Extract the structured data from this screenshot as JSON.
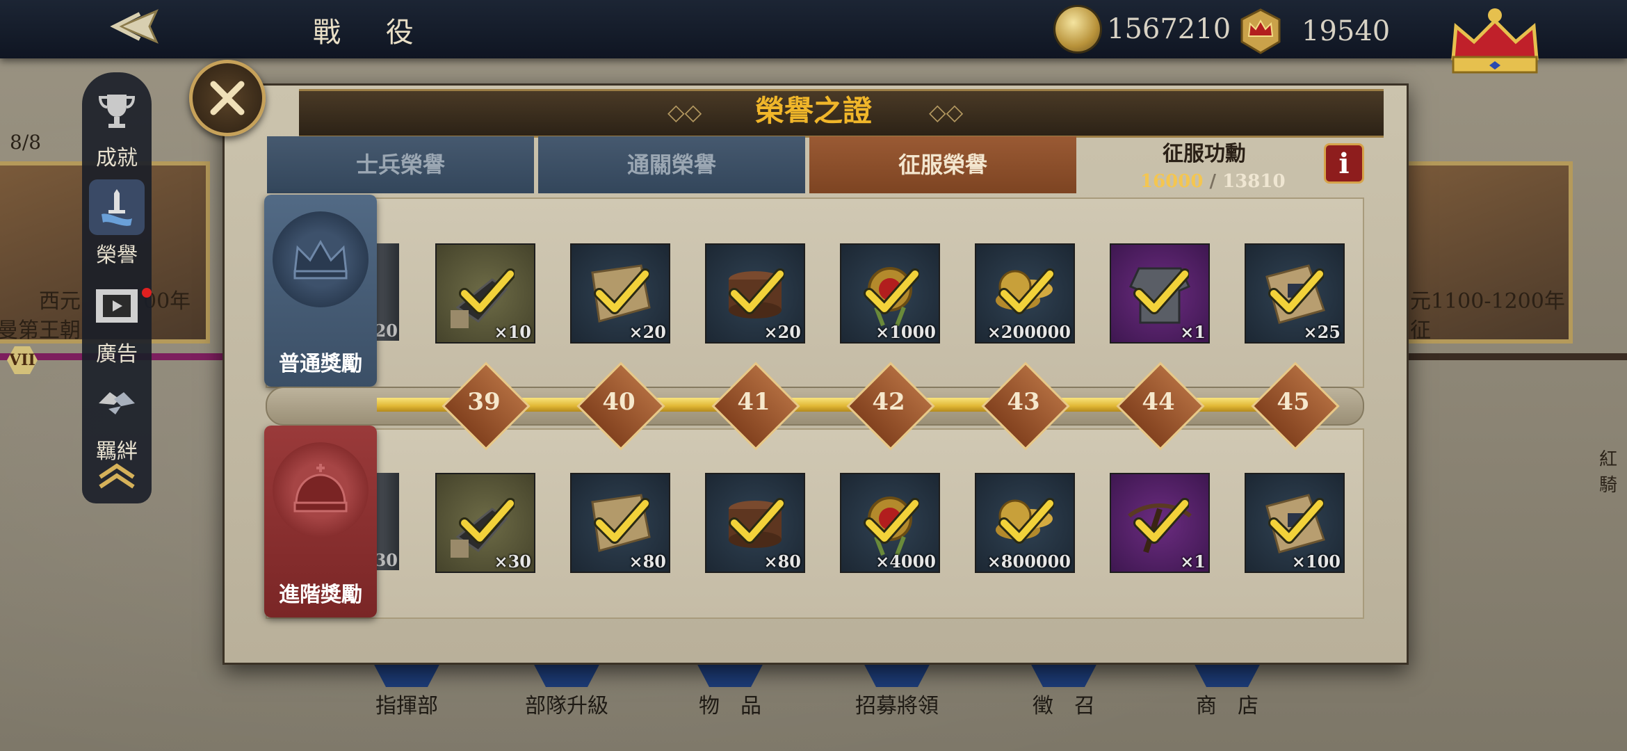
{
  "header": {
    "title": "戰 役",
    "gold": "1567210",
    "honor_points": "19540"
  },
  "background": {
    "stage_count": "8/8",
    "left_era": "西元",
    "left_era_tail": "00年",
    "left_dynasty": "曼第王朝",
    "right_era": "元1100-1200年",
    "right_sub": "征",
    "roman": "VII",
    "right_far": "紅騎"
  },
  "side_menu": [
    {
      "label": "成就",
      "icon": "trophy-icon"
    },
    {
      "label": "榮譽",
      "icon": "sword-scroll-icon"
    },
    {
      "label": "廣告",
      "icon": "film-icon"
    },
    {
      "label": "羈絆",
      "icon": "handshake-icon"
    }
  ],
  "bottom_menu": [
    "指揮部",
    "部隊升級",
    "物　品",
    "招募將領",
    "徵　召",
    "商　店"
  ],
  "modal": {
    "title": "榮譽之證",
    "tabs": [
      "士兵榮譽",
      "通關榮譽",
      "征服榮譽"
    ],
    "active_tab": 2,
    "merit_label": "征服功勳",
    "merit_current": "16000",
    "merit_separator": "/",
    "merit_target": "13810",
    "info_label": "i",
    "normal_label": "普通獎勵",
    "advanced_label": "進階獎勵",
    "levels": [
      "39",
      "40",
      "41",
      "42",
      "43",
      "44",
      "45"
    ],
    "partial_normal_qty": "20",
    "partial_adv_qty": "30",
    "normal_rewards": [
      {
        "icon": "cannon-part-icon",
        "qty": "×10",
        "bg": "olive"
      },
      {
        "icon": "scroll-icon",
        "qty": "×20",
        "bg": "blue"
      },
      {
        "icon": "barrel-icon",
        "qty": "×20",
        "bg": "blue"
      },
      {
        "icon": "medal-icon",
        "qty": "×1000",
        "bg": "blue"
      },
      {
        "icon": "coins-icon",
        "qty": "×200000",
        "bg": "blue"
      },
      {
        "icon": "armor-icon",
        "qty": "×1",
        "bg": "purple"
      },
      {
        "icon": "map-scroll-icon",
        "qty": "×25",
        "bg": "blue"
      }
    ],
    "advanced_rewards": [
      {
        "icon": "cannon-part-icon",
        "qty": "×30",
        "bg": "olive"
      },
      {
        "icon": "scroll-icon",
        "qty": "×80",
        "bg": "blue"
      },
      {
        "icon": "barrel-icon",
        "qty": "×80",
        "bg": "blue"
      },
      {
        "icon": "medal-icon",
        "qty": "×4000",
        "bg": "blue"
      },
      {
        "icon": "coins-icon",
        "qty": "×800000",
        "bg": "blue"
      },
      {
        "icon": "crossbow-icon",
        "qty": "×1",
        "bg": "purple"
      },
      {
        "icon": "map-scroll-icon",
        "qty": "×100",
        "bg": "blue"
      }
    ]
  },
  "colors": {
    "accent_gold": "#f0b62a",
    "merit_current": "#f4c650",
    "merit_target": "#e8e0cc",
    "check": "#f2d23a"
  }
}
